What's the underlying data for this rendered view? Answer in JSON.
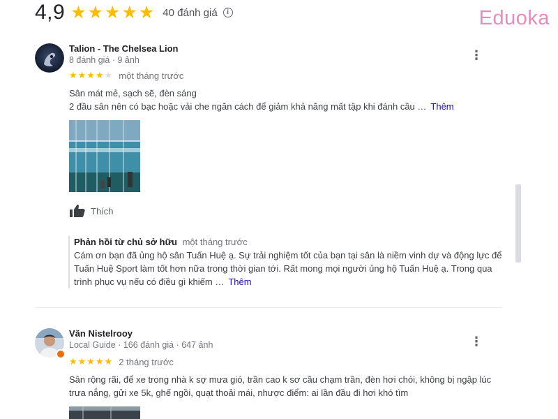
{
  "summary": {
    "score": "4,9",
    "stars": "★★★★★",
    "count_text": "40 đánh giá",
    "info_glyph": "i"
  },
  "logo": {
    "text": "Eduoka"
  },
  "colors": {
    "star": "#fbbc04",
    "link": "#1a0dab",
    "logo": "#e58cbf",
    "badge": "#e8710a"
  },
  "reviews": [
    {
      "name": "Talion - The Chelsea Lion",
      "meta": "8 đánh giá · 9 ảnh",
      "rating": 4,
      "stars_on": "★★★★",
      "stars_off": "★",
      "time": "một tháng trước",
      "text_line1": "Sân mát mẻ, sạch sẽ, đèn sáng",
      "text_line2": "2 đầu sân nên có bạc hoặc vải che ngăn cách để giảm khả năng mất tập khi đánh cầu …",
      "more_label": "Thêm",
      "like_label": "Thích",
      "owner_reply": {
        "title": "Phản hồi từ chủ sở hữu",
        "time": "một tháng trước",
        "text": "Cám ơn bạn đã ủng hộ sân Tuấn Huệ ạ. Sự trải nghiệm tốt của bạn tại sân là niềm vinh dự và động lực để Tuấn Huệ Sport làm tốt hơn nữa trong thời gian tới. Rất mong mọi người ủng hộ Tuấn Huệ ạ. Trong qua trình phục vụ nếu có điều gì khiếm …",
        "more_label": "Thêm"
      }
    },
    {
      "name": "Văn Nistelrooy",
      "meta": "Local Guide · 166 đánh giá · 647 ảnh",
      "rating": 5,
      "stars_on": "★★★★★",
      "stars_off": "",
      "time": "2 tháng trước",
      "text": "Sân rộng rãi, để xe trong nhà k sợ mưa gió, trần cao k sơ cầu chạm trần, đèn hơi chói, không bị ngập lúc trưa nắng, gửi xe 5k, ghế ngồi, quạt thoải mái, nhược điểm: ai lần đầu đi hơi khó tìm"
    }
  ]
}
